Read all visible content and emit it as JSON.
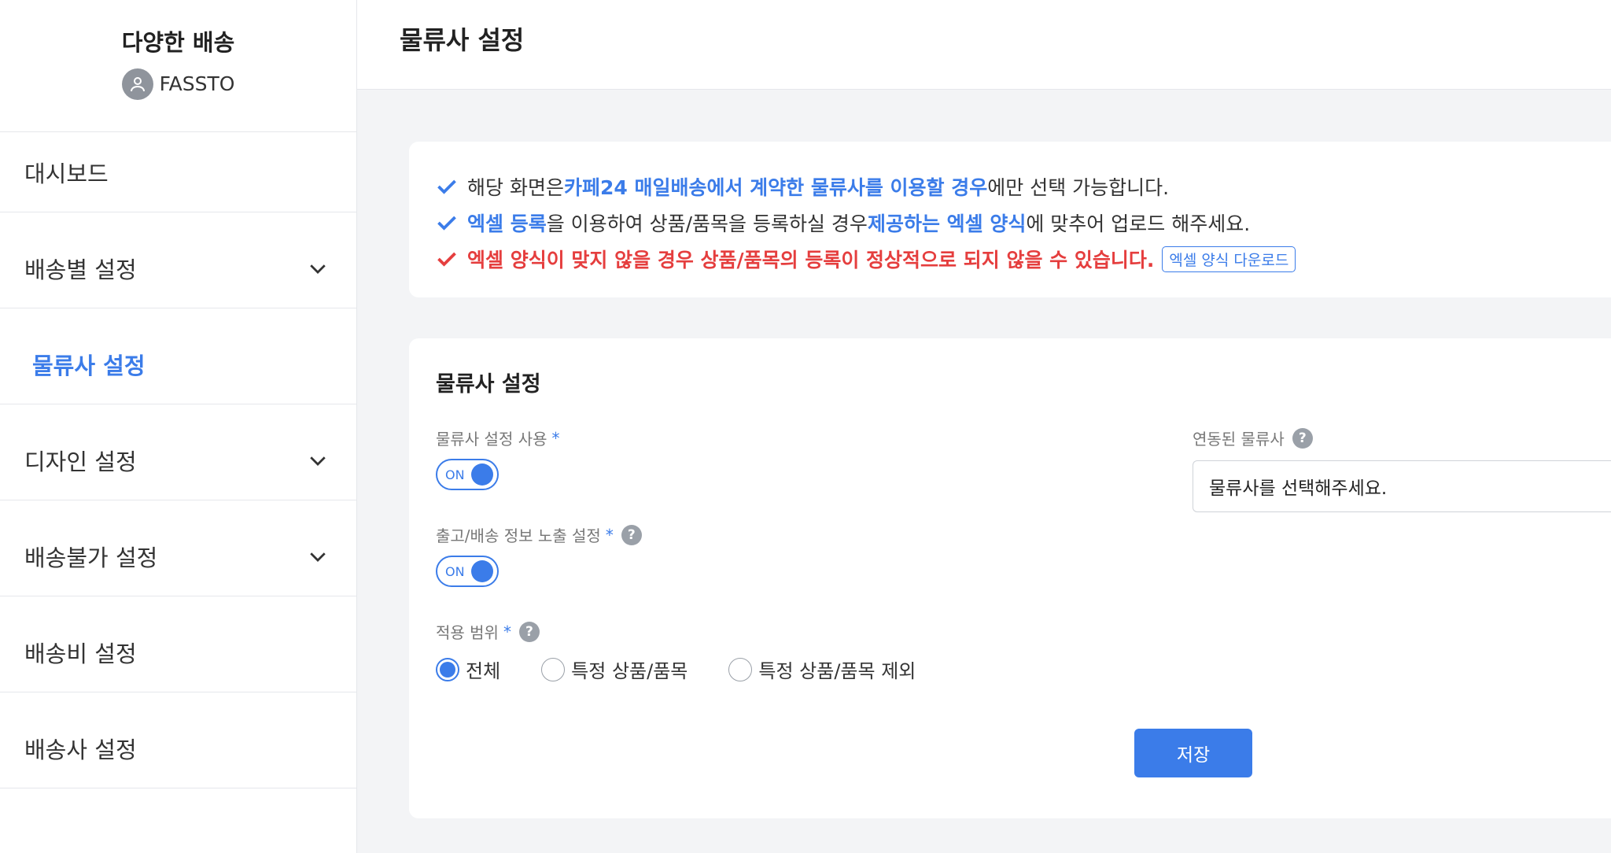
{
  "brand": {
    "title": "다양한 배송",
    "user": "FASSTO"
  },
  "sidebar": {
    "items": [
      {
        "label": "대시보드",
        "has_chevron": false
      },
      {
        "label": "배송별 설정",
        "has_chevron": true
      },
      {
        "label": "물류사 설정",
        "has_chevron": false,
        "active": true
      },
      {
        "label": "디자인 설정",
        "has_chevron": true
      },
      {
        "label": "배송불가 설정",
        "has_chevron": true
      },
      {
        "label": "배송비 설정",
        "has_chevron": false
      },
      {
        "label": "배송사 설정",
        "has_chevron": false
      }
    ]
  },
  "header": {
    "title": "물류사 설정"
  },
  "notice": {
    "line1": {
      "pre": "해당 화면은 ",
      "hl": "카페24 매일배송에서 계약한 물류사를 이용할 경우",
      "post": "에만 선택 가능합니다."
    },
    "line2": {
      "hl1": "엑셀 등록",
      "mid": "을 이용하여 상품/품목을 등록하실 경우 ",
      "hl2": "제공하는 엑셀 양식",
      "post": "에 맞추어 업로드 해주세요."
    },
    "line3": {
      "warn": "엑셀 양식이 맞지 않을 경우 상품/품목의 등록이 정상적으로 되지 않을 수 있습니다.",
      "button": "엑셀 양식 다운로드"
    }
  },
  "panel": {
    "title": "물류사 설정",
    "use_setting": {
      "label": "물류사 설정 사용",
      "required": "*",
      "toggle": "ON"
    },
    "shipping_info": {
      "label": "출고/배송 정보 노출 설정",
      "required": "*",
      "toggle": "ON"
    },
    "scope": {
      "label": "적용 범위",
      "required": "*",
      "options": [
        "전체",
        "특정 상품/품목",
        "특정 상품/품목 제외"
      ],
      "selected": 0
    },
    "linked": {
      "label": "연동된 물류사",
      "placeholder": "물류사를 선택해주세요."
    },
    "save_label": "저장"
  },
  "colors": {
    "accent": "#3b7ce9",
    "warn": "#e53e3e"
  }
}
